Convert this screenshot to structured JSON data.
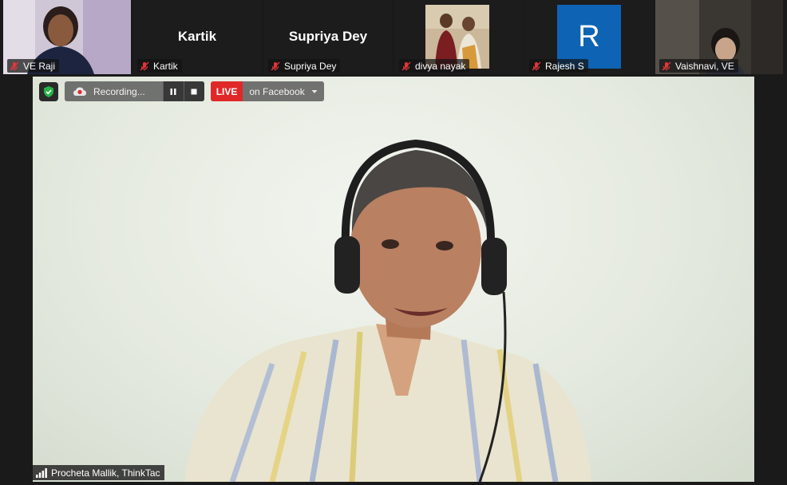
{
  "participants": [
    {
      "name": "VE Raji",
      "display": "video",
      "muted": true
    },
    {
      "name": "Kartik",
      "display": "name",
      "big_name": "Kartik",
      "muted": true
    },
    {
      "name": "Supriya Dey",
      "display": "name",
      "big_name": "Supriya Dey",
      "muted": true
    },
    {
      "name": "divya nayak",
      "display": "photo",
      "muted": true
    },
    {
      "name": "Rajesh S",
      "display": "avatar",
      "avatar_letter": "R",
      "muted": true
    },
    {
      "name": "Vaishnavi, VE",
      "display": "video",
      "muted": true
    }
  ],
  "toolbar": {
    "recording_label": "Recording...",
    "pause_icon": "pause-icon",
    "stop_icon": "stop-icon",
    "live_label": "LIVE",
    "live_destination": "on Facebook"
  },
  "speaker": {
    "name": "Procheta Mallik, ThinkTac"
  },
  "colors": {
    "live_red": "#e02828",
    "avatar_blue": "#0e63b5",
    "shield_green": "#27b24a",
    "muted_red": "#e0363a"
  }
}
